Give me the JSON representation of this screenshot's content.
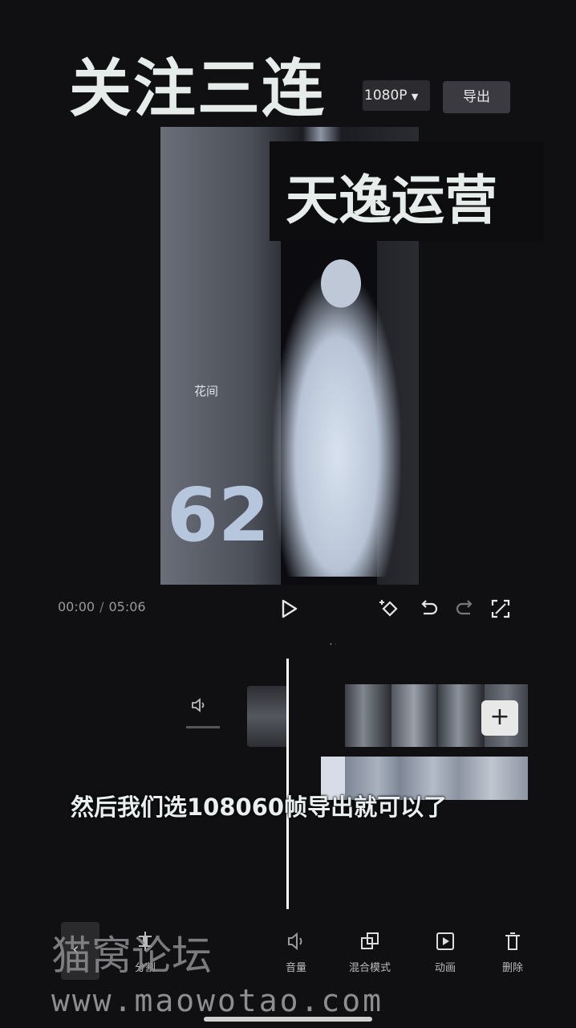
{
  "overlay": {
    "title": "关注三连",
    "brand": "天逸运营"
  },
  "header": {
    "resolution": "1080P",
    "export_label": "导出"
  },
  "preview": {
    "poster_text": "花间",
    "scribble": "62"
  },
  "transport": {
    "current_time": "00:00",
    "separator": "/",
    "total_time": "05:06"
  },
  "timeline": {
    "add_label": "+",
    "ruler_text": "• ·"
  },
  "subtitle": "然后我们选108060帧导出就可以了",
  "toolbar": {
    "items": [
      {
        "label": "分割"
      },
      {
        "label": "音量"
      },
      {
        "label": "混合模式"
      },
      {
        "label": "动画"
      },
      {
        "label": "删除"
      }
    ]
  },
  "watermark": {
    "name": "猫窝论坛",
    "url": "www.maowotao.com"
  },
  "colors": {
    "background": "#101012",
    "text": "#e6ecea"
  }
}
